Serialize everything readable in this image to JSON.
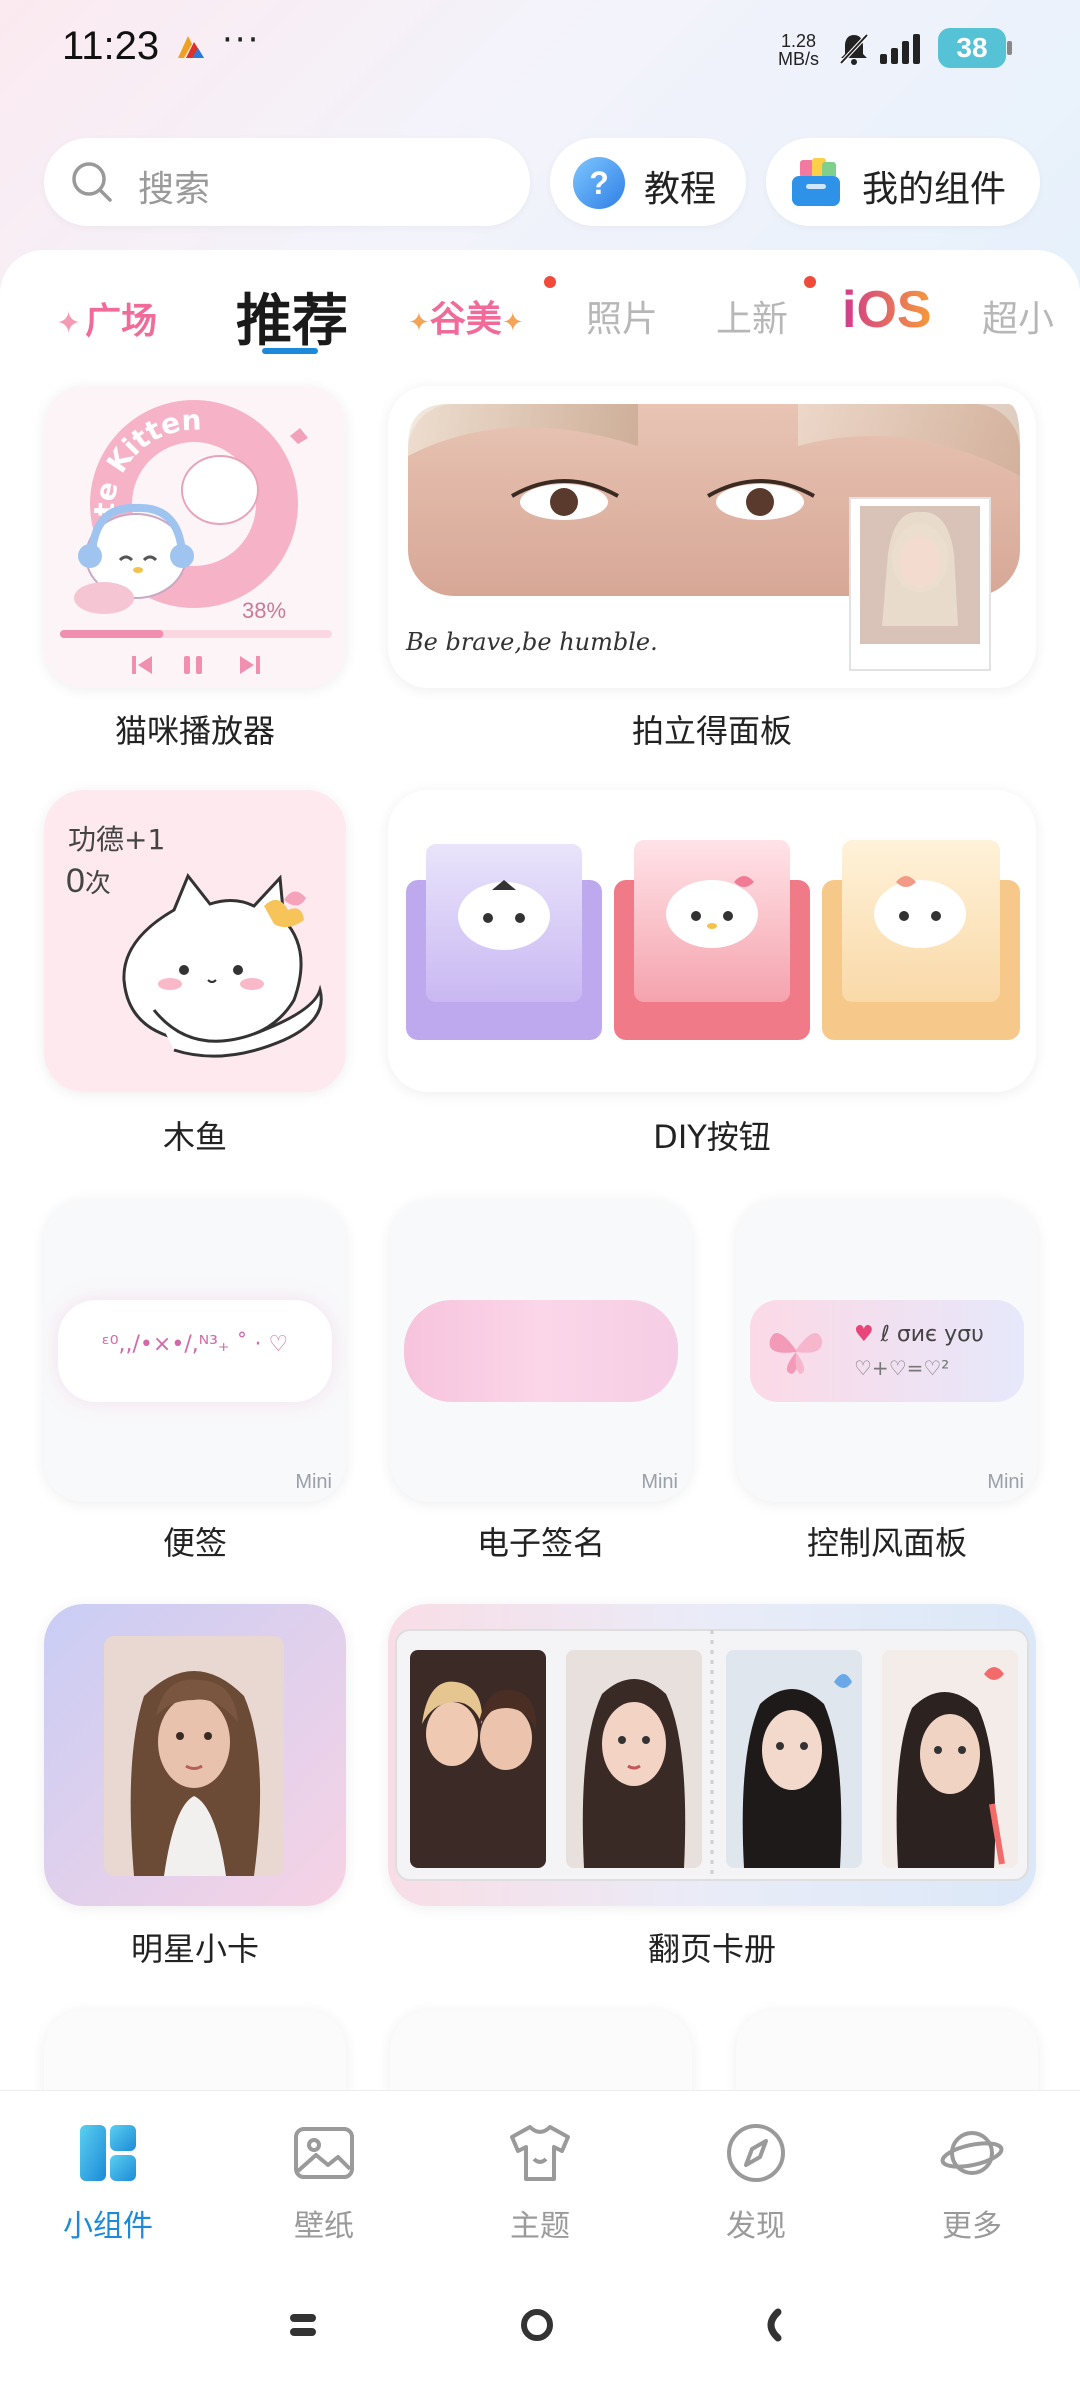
{
  "status_bar": {
    "time": "11:23",
    "more_dots": "···",
    "net_speed_value": "1.28",
    "net_speed_unit": "MB/s",
    "battery": "38"
  },
  "header": {
    "search_placeholder": "搜索",
    "tutorial_label": "教程",
    "my_widgets_label": "我的组件"
  },
  "tabs": {
    "guangchang": "广场",
    "tuijian": "推荐",
    "gumei": "谷美",
    "zhaopian": "照片",
    "shangxin": "上新",
    "ios": "iOS",
    "chao": "超小"
  },
  "widgets": {
    "cat_player": {
      "label": "猫咪播放器",
      "ring_text": "te Kitten",
      "progress_text": "38%",
      "progress": 0.38
    },
    "polaroid": {
      "label": "拍立得面板",
      "caption": "Be brave,be humble."
    },
    "muyu": {
      "label": "木鱼",
      "merit_text": "功德+1",
      "count": "0",
      "count_unit": "次"
    },
    "diy_button": {
      "label": "DIY按钮"
    },
    "note": {
      "label": "便签",
      "note_text": "ᵋ⁰,,/•×•/,ᴺ³₊ ˚ · ♡",
      "mini_tag": "Mini"
    },
    "esign": {
      "label": "电子签名",
      "mini_tag": "Mini"
    },
    "control_panel": {
      "label": "控制风面板",
      "line1": "ℓ σиє уσυ",
      "line2": "♡+♡=♡²",
      "mini_tag": "Mini"
    },
    "star_card": {
      "label": "明星小卡"
    },
    "flip_album": {
      "label": "翻页卡册"
    }
  },
  "bottom_nav": {
    "items": [
      {
        "label": "小组件",
        "icon": "widget-grid-icon",
        "active": true
      },
      {
        "label": "壁纸",
        "icon": "picture-icon",
        "active": false
      },
      {
        "label": "主题",
        "icon": "tshirt-icon",
        "active": false
      },
      {
        "label": "发现",
        "icon": "compass-icon",
        "active": false
      },
      {
        "label": "更多",
        "icon": "planet-icon",
        "active": false
      }
    ]
  },
  "colors": {
    "accent": "#1c8ad8",
    "pink": "#f06a9a",
    "battery": "#55c2d6"
  }
}
